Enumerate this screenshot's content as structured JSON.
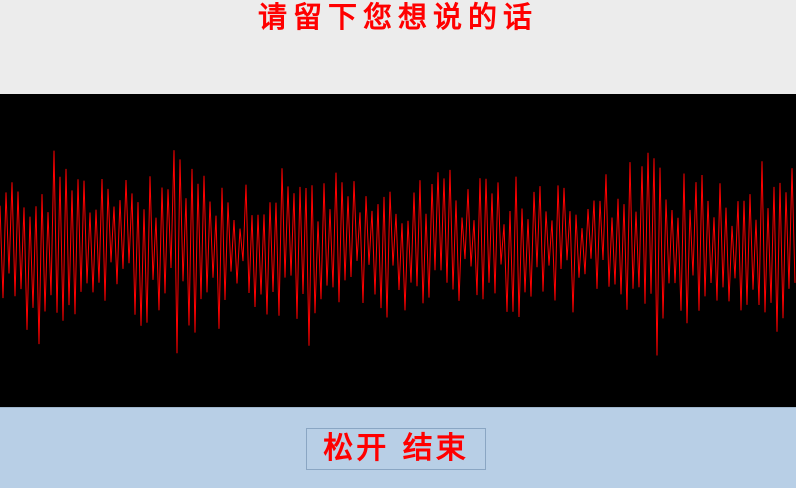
{
  "header": {
    "title": "请留下您想说的话"
  },
  "waveform": {
    "color": "#ff0000",
    "background": "#000000"
  },
  "footer": {
    "button_label": "松开 结束"
  }
}
